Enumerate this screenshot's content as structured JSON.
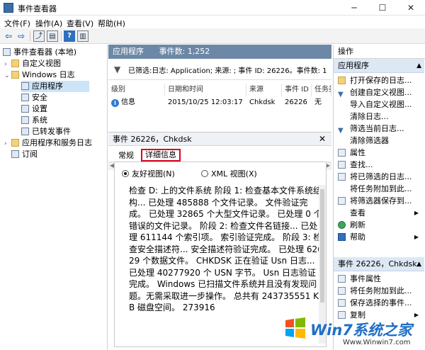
{
  "window": {
    "title": "事件查看器",
    "minimize": "─",
    "maximize": "☐",
    "close": "✕"
  },
  "menu": [
    "文件(F)",
    "操作(A)",
    "查看(V)",
    "帮助(H)"
  ],
  "toolbar": {
    "back": "⇦",
    "forward": "⇨",
    "help": "?"
  },
  "tree": {
    "root": "事件查看器 (本地)",
    "custom_views": "自定义视图",
    "windows_logs": "Windows 日志",
    "application": "应用程序",
    "security": "安全",
    "setup": "设置",
    "system": "系统",
    "forwarded": "已转发事件",
    "apps_services": "应用程序和服务日志",
    "subscriptions": "订阅"
  },
  "middle": {
    "log_name": "应用程序",
    "event_count": "事件数: 1,252",
    "filter_text": "已筛选:日志: Application; 来源: ; 事件 ID: 26226。事件数: 1",
    "columns": [
      "级别",
      "日期和时间",
      "来源",
      "事件 ID",
      "任务类"
    ],
    "row": {
      "level": "信息",
      "datetime": "2015/10/25 12:03:17",
      "source": "Chkdsk",
      "event_id": "26226",
      "task": "无"
    },
    "detail_title": "事件 26226，Chkdsk",
    "tabs": [
      "常规",
      "详细信息"
    ],
    "radio_friendly": "友好视图(N)",
    "radio_xml": "XML 视图(X)",
    "detail_text": "检查 D: 上的文件系统 阶段 1: 检查基本文件系统结构... 已处理 485888 个文件记录。 文件验证完成。 已处理 32865 个大型文件记录。 已处理 0 个错误的文件记录。 阶段 2: 检查文件名链接... 已处理 611144 个索引项。 索引验证完成。 阶段 3: 检查安全描述符... 安全描述符验证完成。 已处理 62629 个数据文件。 CHKDSK 正在验证 Usn 日志... 已处理 40277920 个 USN 字节。 Usn 日志验证完成。 Windows 已扫描文件系统并且没有发现问题。无需采取进一步操作。 总共有 243735551 KB 磁盘空间。 273916"
  },
  "actions": {
    "header": "操作",
    "section1": "应用程序",
    "items1": [
      "打开保存的日志...",
      "创建自定义视图...",
      "导入自定义视图...",
      "清除日志...",
      "筛选当前日志...",
      "清除筛选器",
      "属性",
      "查找...",
      "将已筛选的日志...",
      "将任务附加到此...",
      "将筛选器保存到...",
      "查看",
      "刷新",
      "帮助"
    ],
    "section2": "事件 26226，Chkdsk",
    "items2": [
      "事件属性",
      "将任务附加到此...",
      "保存选择的事件...",
      "复制"
    ]
  },
  "watermark": {
    "brand": "Win7系统之家",
    "url": "Www.Winwin7.com"
  }
}
